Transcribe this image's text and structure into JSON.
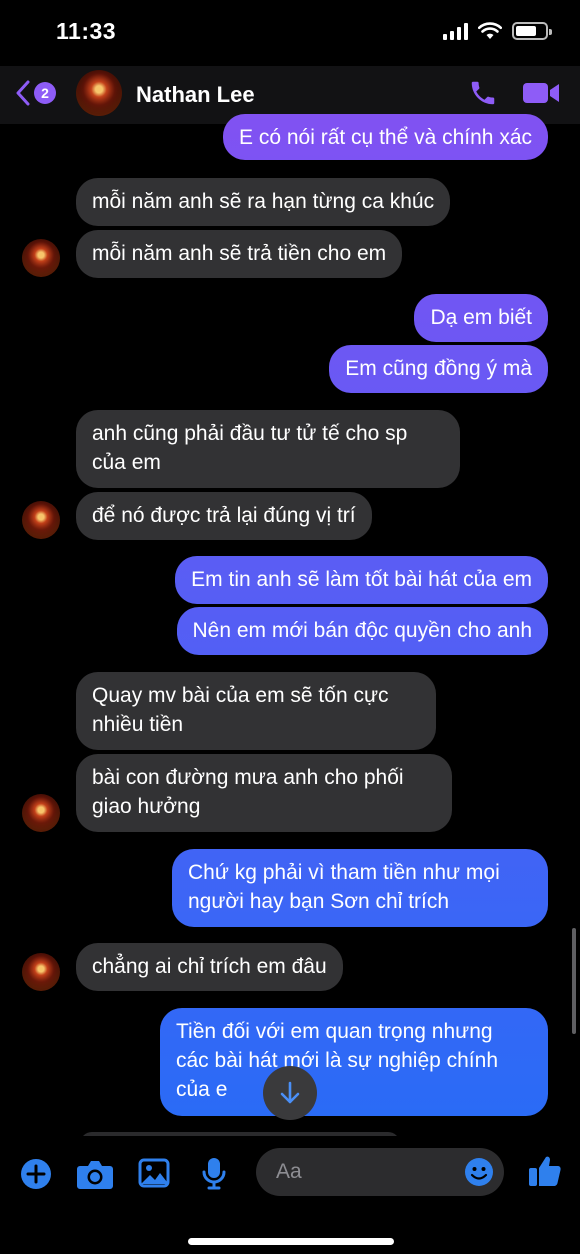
{
  "status_bar": {
    "time": "11:33"
  },
  "header": {
    "back_count": "2",
    "contact_name": "Nathan Lee"
  },
  "messages": [
    {
      "side": "out",
      "text": "E có nói rất cụ thể và chính xác"
    },
    {
      "side": "in",
      "text": "mỗi năm anh sẽ ra hạn từng ca khúc"
    },
    {
      "side": "in",
      "text": "mỗi năm anh sẽ trả tiền cho em"
    },
    {
      "side": "out",
      "text": "Dạ em biết"
    },
    {
      "side": "out",
      "text": "Em cũng đồng ý mà"
    },
    {
      "side": "in",
      "text": "anh cũng phải đầu tư tử tế cho sp\ncủa em"
    },
    {
      "side": "in",
      "text": "để nó được trả lại đúng vị trí"
    },
    {
      "side": "out",
      "text": "Em tin anh sẽ làm tốt bài hát của em"
    },
    {
      "side": "out",
      "text": "Nên em mới bán độc quyền cho anh"
    },
    {
      "side": "in",
      "text": "Quay mv bài của em sẽ tốn cực\nnhiều tiền"
    },
    {
      "side": "in",
      "text": "bài con đường mưa anh cho phối\ngiao hưởng"
    },
    {
      "side": "out",
      "text": "Chứ kg phải vì tham tiền như mọi\nngười hay bạn Sơn chỉ trích"
    },
    {
      "side": "in",
      "text": "chẳng ai chỉ trích em đâu"
    },
    {
      "side": "out",
      "text": "Tiền đối với em quan trọng nhưng\ncác bài hát mới là sự nghiệp chính\ncủa e"
    }
  ],
  "composer": {
    "placeholder": "Aa",
    "icons": [
      "plus-circle-icon",
      "camera-icon",
      "image-icon",
      "microphone-icon",
      "emoji-icon",
      "thumbs-up-icon"
    ]
  },
  "colors": {
    "accent": "#8e5cf7",
    "bubble_in": "#323234",
    "gradient_top": "#8b4ff2",
    "gradient_bottom": "#1e6ef7"
  }
}
